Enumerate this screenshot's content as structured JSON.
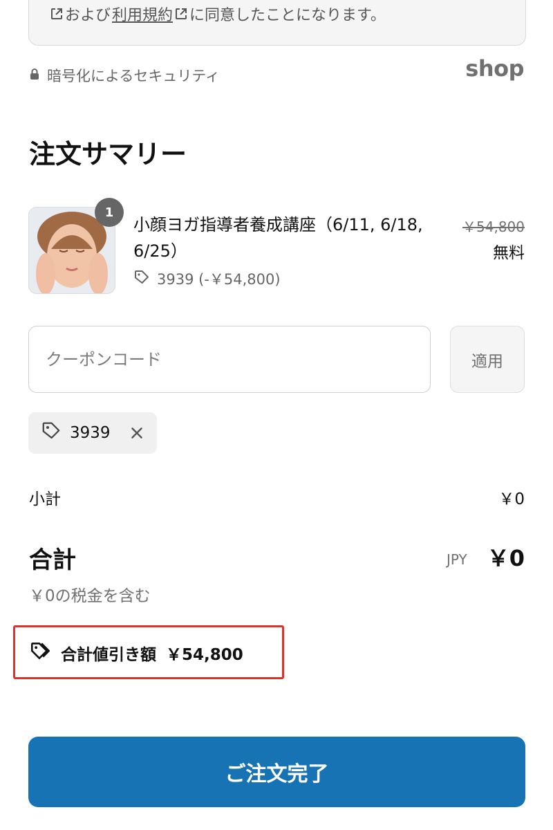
{
  "consent": {
    "prefix": "および",
    "terms_link": "利用規約",
    "suffix": "に同意したことになります。"
  },
  "security": {
    "label": "暗号化によるセキュリティ"
  },
  "brand": {
    "logo_text": "shop"
  },
  "summary": {
    "title": "注文サマリー",
    "product": {
      "name": "小顔ヨガ指導者養成講座（6/11, 6/18, 6/25）",
      "quantity": "1",
      "discount_code_line": "3939 (-￥54,800)",
      "original_price": "￥54,800",
      "price": "無料"
    },
    "coupon": {
      "placeholder": "クーポンコード",
      "apply_label": "適用",
      "applied_code": "3939"
    },
    "subtotal": {
      "label": "小計",
      "value": "￥0"
    },
    "total": {
      "label": "合計",
      "currency": "JPY",
      "value": "￥0"
    },
    "tax_note": "￥0の税金を含む",
    "total_discount": {
      "label": "合計値引き額",
      "value": "￥54,800"
    }
  },
  "checkout": {
    "button_label": "ご注文完了"
  },
  "colors": {
    "primary_button": "#1873b5",
    "highlight_border": "#d9332b",
    "badge": "#666666"
  },
  "icons": [
    "external-link-icon",
    "lock-icon",
    "tag-icon",
    "close-icon"
  ]
}
